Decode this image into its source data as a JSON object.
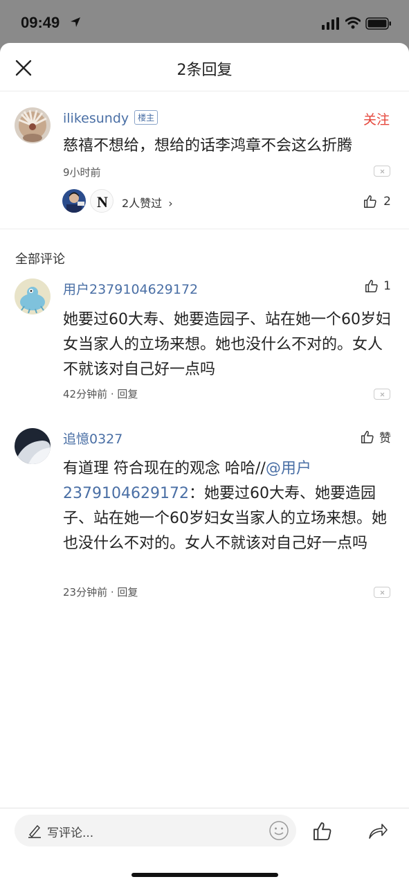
{
  "status_bar": {
    "time": "09:49"
  },
  "header": {
    "title": "2条回复"
  },
  "main_post": {
    "username": "ilikesundy",
    "badge": "楼主",
    "follow_label": "关注",
    "text": "慈禧不想给，想给的话李鸿章不会这么折腾",
    "time": "9小时前",
    "likers_label": "2人赞过",
    "likers_chevron": "›",
    "like_count": "2",
    "liker_2_initial": "N"
  },
  "section_label": "全部评论",
  "comments": [
    {
      "username": "用户2379104629172",
      "text": "她要过60大寿、她要造园子、站在她一个60岁妇女当家人的立场来想。她也没什么不对的。女人不就该对自己好一点吗",
      "meta": "42分钟前 · 回复",
      "like_label": "1"
    },
    {
      "username": "追憶0327",
      "text_prefix": "有道理 符合现在的观念 哈哈//",
      "mention": "@用户2379104629172",
      "text_suffix": "：她要过60大寿、她要造园子、站在她一个60岁妇女当家人的立场来想。她也没什么不对的。女人不就该对自己好一点吗",
      "meta": "23分钟前 · 回复",
      "like_label": "赞"
    }
  ],
  "bottom_bar": {
    "placeholder": "写评论..."
  },
  "colors": {
    "link": "#4a6fa5",
    "follow": "#e5463b",
    "status_bg": "#8a8a8a"
  }
}
